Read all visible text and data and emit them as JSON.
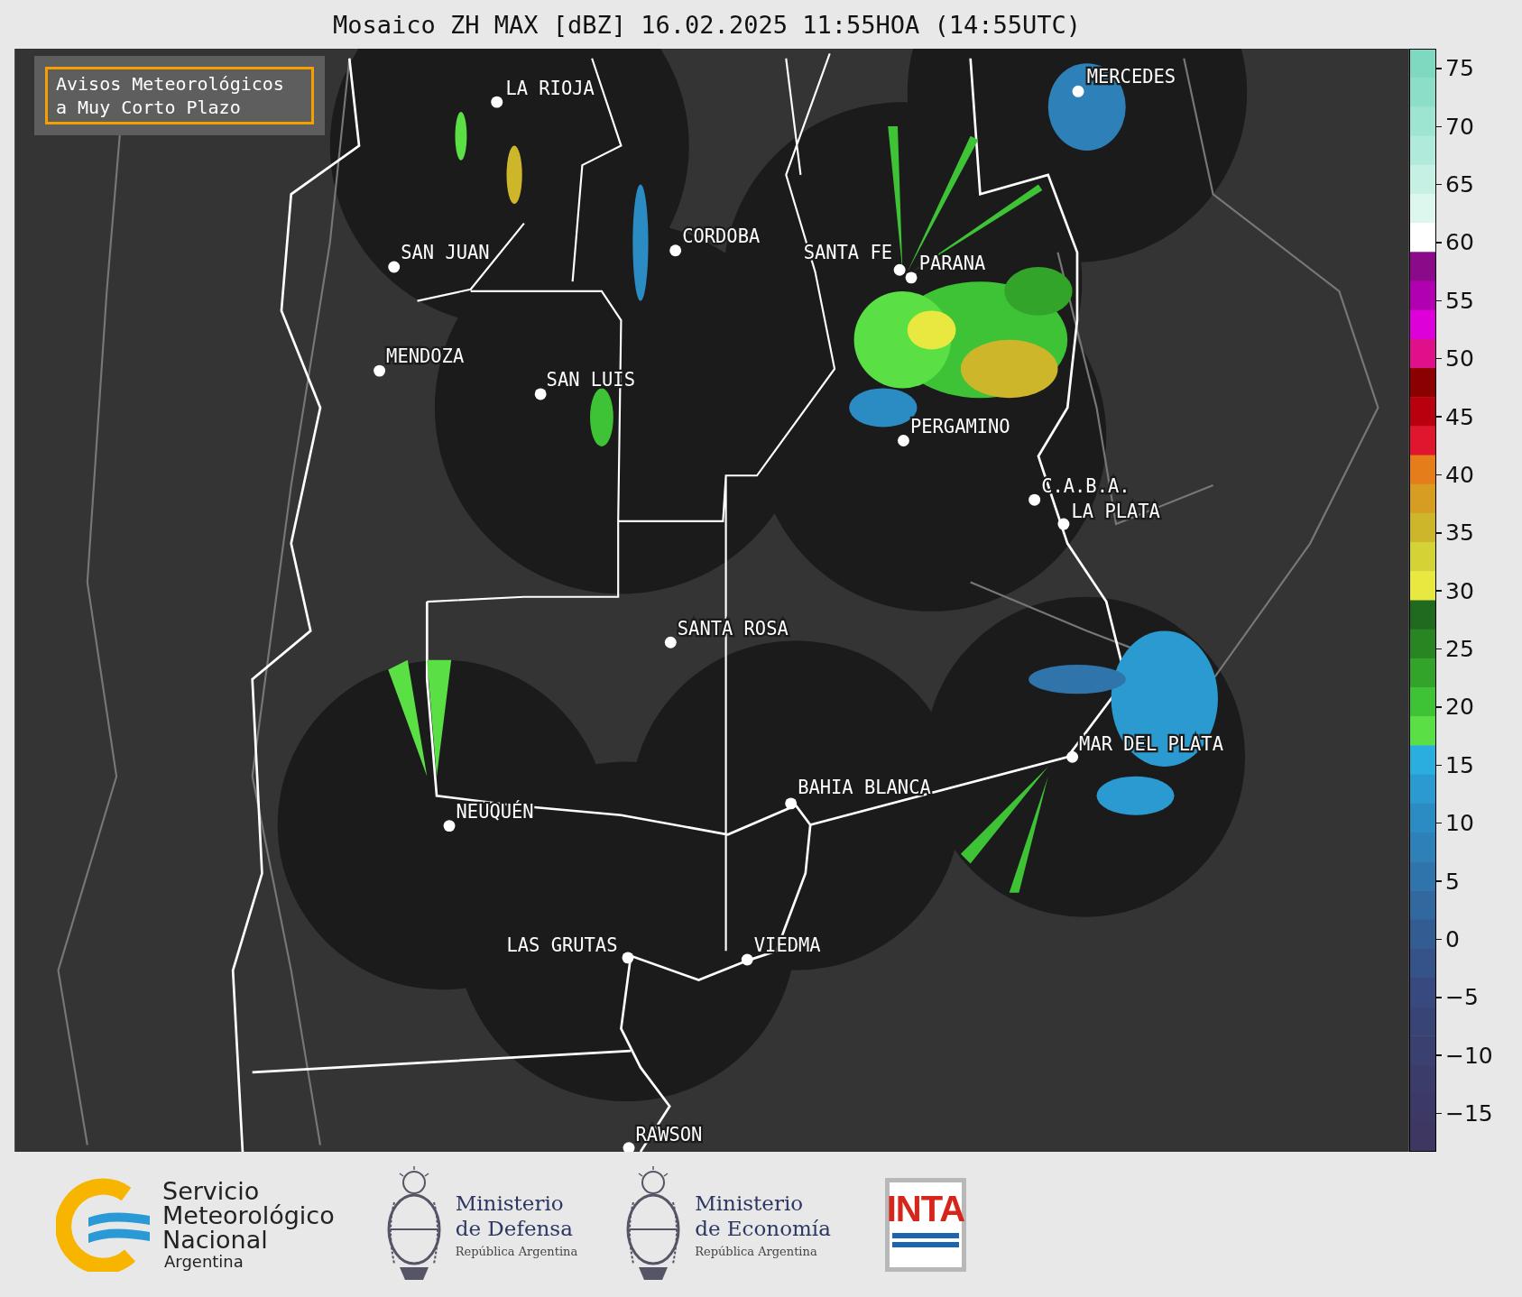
{
  "title": "Mosaico ZH MAX [dBZ] 16.02.2025 11:55HOA (14:55UTC)",
  "notice": {
    "lines": [
      "Avisos Meteorológicos",
      "a Muy Corto Plazo"
    ]
  },
  "cities": [
    {
      "name": "LA RIOJA"
    },
    {
      "name": "MERCEDES"
    },
    {
      "name": "SAN JUAN"
    },
    {
      "name": "CORDOBA"
    },
    {
      "name": "SANTA FE"
    },
    {
      "name": "PARANA"
    },
    {
      "name": "MENDOZA"
    },
    {
      "name": "SAN LUIS"
    },
    {
      "name": "PERGAMINO"
    },
    {
      "name": "C.A.B.A."
    },
    {
      "name": "LA PLATA"
    },
    {
      "name": "SANTA ROSA"
    },
    {
      "name": "MAR DEL PLATA"
    },
    {
      "name": "BAHIA BLANCA"
    },
    {
      "name": "NEUQUÉN"
    },
    {
      "name": "LAS GRUTAS"
    },
    {
      "name": "VIEDMA"
    },
    {
      "name": "RAWSON"
    }
  ],
  "colorbar": {
    "ticks": [
      "75",
      "70",
      "65",
      "60",
      "55",
      "50",
      "45",
      "40",
      "35",
      "30",
      "25",
      "20",
      "15",
      "10",
      "5",
      "0",
      "−5",
      "−10",
      "−15"
    ],
    "segments": [
      {
        "color": "#7fd9c0"
      },
      {
        "color": "#8cdec8"
      },
      {
        "color": "#9de4d1"
      },
      {
        "color": "#b0eadb"
      },
      {
        "color": "#c6f0e4"
      },
      {
        "color": "#ddf6ee"
      },
      {
        "color": "#ffffff"
      },
      {
        "color": "#8a0a8a"
      },
      {
        "color": "#b000b0"
      },
      {
        "color": "#de00d8"
      },
      {
        "color": "#e0108a"
      },
      {
        "color": "#8b0000"
      },
      {
        "color": "#b8000e"
      },
      {
        "color": "#e0152e"
      },
      {
        "color": "#e57e1a"
      },
      {
        "color": "#d79d22"
      },
      {
        "color": "#cdb62a"
      },
      {
        "color": "#d4d335"
      },
      {
        "color": "#e8e840"
      },
      {
        "color": "#1f6a1f"
      },
      {
        "color": "#288522"
      },
      {
        "color": "#33a42a"
      },
      {
        "color": "#3ec236"
      },
      {
        "color": "#5ae045"
      },
      {
        "color": "#2aaee0"
      },
      {
        "color": "#2a9ad0"
      },
      {
        "color": "#2b8cc4"
      },
      {
        "color": "#2d80b8"
      },
      {
        "color": "#2f74aa"
      },
      {
        "color": "#31689e"
      },
      {
        "color": "#335d92"
      },
      {
        "color": "#355388"
      },
      {
        "color": "#37497e"
      },
      {
        "color": "#384476"
      },
      {
        "color": "#3a406f"
      },
      {
        "color": "#3b3c6a"
      },
      {
        "color": "#3c3966"
      },
      {
        "color": "#3d3762"
      }
    ]
  },
  "footer": {
    "smn": {
      "lines": [
        "Servicio",
        "Meteorológico",
        "Nacional"
      ],
      "country": "Argentina"
    },
    "ministries": [
      {
        "name": "Ministerio",
        "sub": "de Defensa",
        "country": "República Argentina"
      },
      {
        "name": "Ministerio",
        "sub": "de Economía",
        "country": "República Argentina"
      }
    ],
    "inta": "INTA"
  }
}
